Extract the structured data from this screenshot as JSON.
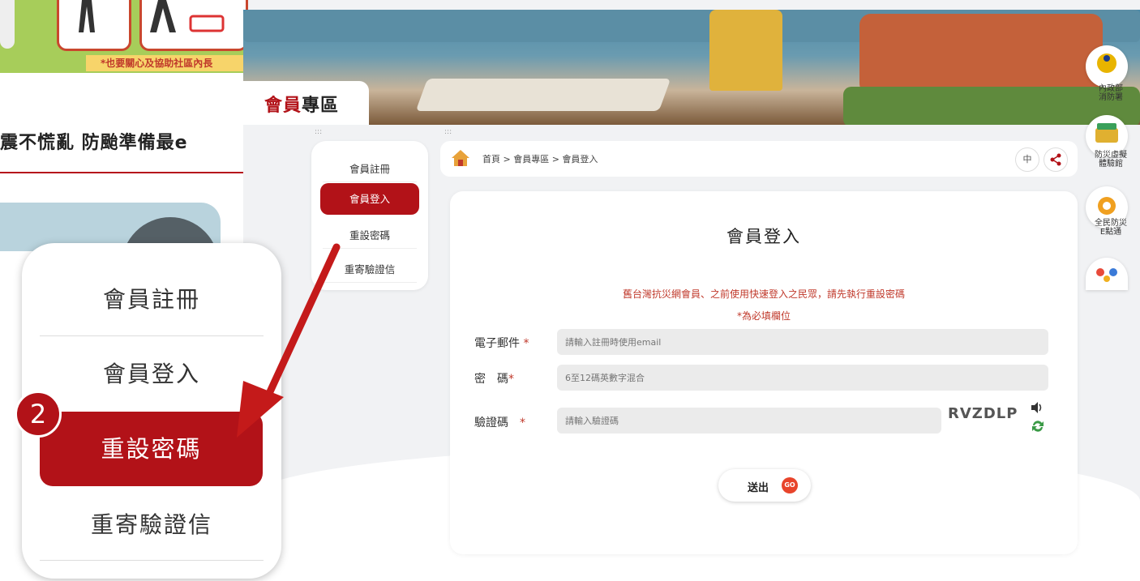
{
  "background": {
    "banner_note": "*也要關心及協助社區內長",
    "headline": "震不慌亂 防颱準備最e"
  },
  "zoom": {
    "items": [
      "會員註冊",
      "會員登入",
      "重設密碼",
      "重寄驗證信"
    ],
    "step": "2"
  },
  "banner": {
    "title_strong": "會員",
    "title_rest": "專區"
  },
  "sidebar": {
    "items": [
      "會員註冊",
      "會員登入",
      "重設密碼",
      "重寄驗證信"
    ],
    "active_index": 1
  },
  "breadcrumb": {
    "text": "首頁 > 會員專區 > 會員登入",
    "lang": "中"
  },
  "login": {
    "title": "會員登入",
    "notice": "舊台灣抗災網會員、之前使用快速登入之民眾，請先執行重設密碼",
    "required": "*為必填欄位",
    "email_label": "電子郵件",
    "email_placeholder": "請輸入註冊時使用email",
    "password_label": "密　碼",
    "password_placeholder": "6至12碼英數字混合",
    "captcha_label": "驗證碼",
    "captcha_placeholder": "請輸入驗證碼",
    "captcha_text": "RVZDLP",
    "star": "*",
    "submit": "送出",
    "go": "GO"
  },
  "right_links": [
    {
      "label": "內政部\n消防署"
    },
    {
      "label": "防災虛擬\n體驗館"
    },
    {
      "label": "全民防災\nE點通"
    }
  ],
  "colors": {
    "accent": "#b21218",
    "notice": "#c0392b"
  }
}
